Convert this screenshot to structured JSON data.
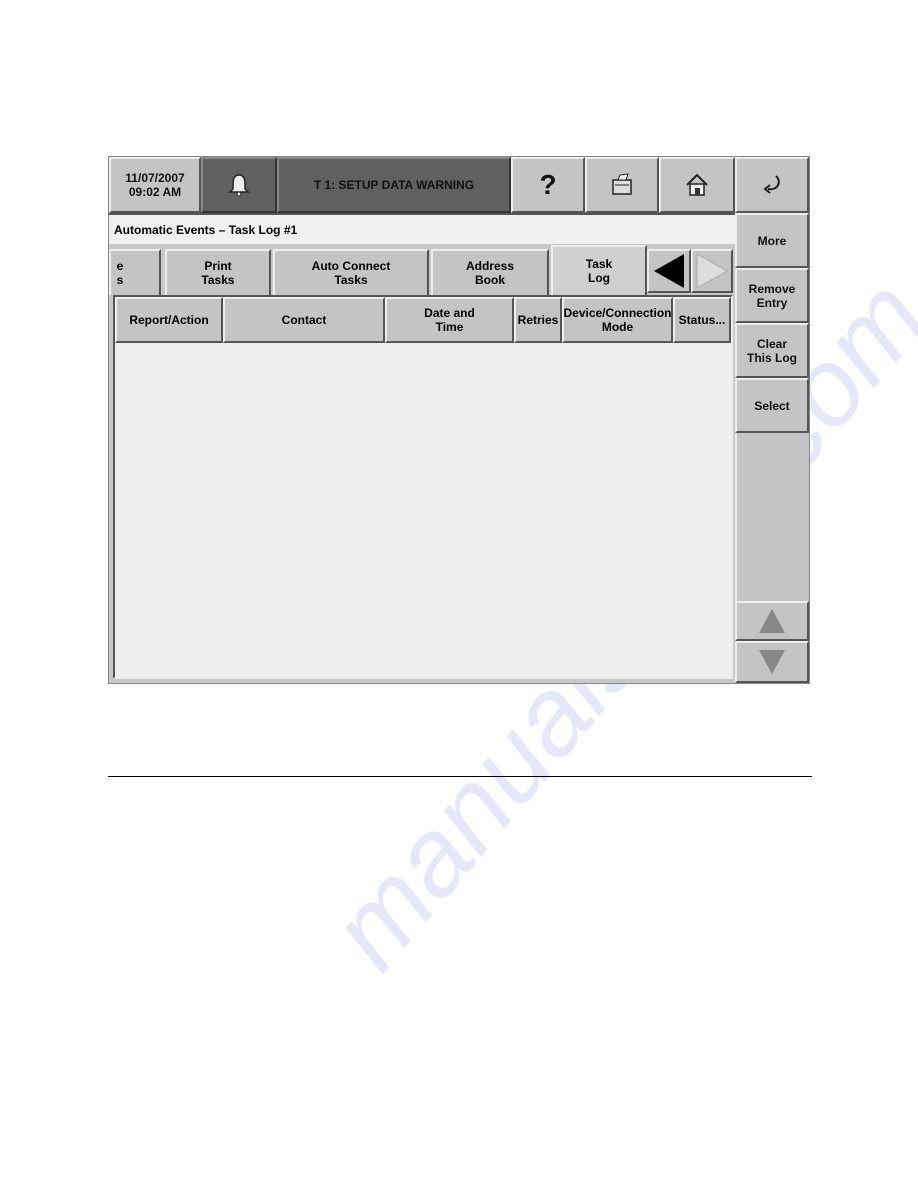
{
  "header": {
    "date": "11/07/2007",
    "time": "09:02 AM",
    "alarm_icon": "bell-icon",
    "warning": "T 1: SETUP DATA WARNING",
    "help_icon": "question-mark-icon",
    "printer_icon": "printer-icon",
    "home_icon": "home-icon",
    "back_icon": "return-arrow-icon"
  },
  "title": "Automatic Events – Task Log #1",
  "tabs": [
    {
      "label1": "e",
      "label2": "s"
    },
    {
      "label1": "Print",
      "label2": "Tasks"
    },
    {
      "label1": "Auto Connect",
      "label2": "Tasks"
    },
    {
      "label1": "Address",
      "label2": "Book"
    },
    {
      "label1": "Task",
      "label2": "Log"
    }
  ],
  "columns": [
    {
      "l1": "Report/Action",
      "l2": ""
    },
    {
      "l1": "Contact",
      "l2": ""
    },
    {
      "l1": "Date and",
      "l2": "Time"
    },
    {
      "l1": "Retries",
      "l2": ""
    },
    {
      "l1": "Device/Connection",
      "l2": "Mode"
    },
    {
      "l1": "Status...",
      "l2": ""
    }
  ],
  "side": [
    {
      "l1": "More",
      "l2": ""
    },
    {
      "l1": "Remove",
      "l2": "Entry"
    },
    {
      "l1": "Clear",
      "l2": "This Log"
    },
    {
      "l1": "Select",
      "l2": ""
    }
  ],
  "watermark": "manualshive.com"
}
